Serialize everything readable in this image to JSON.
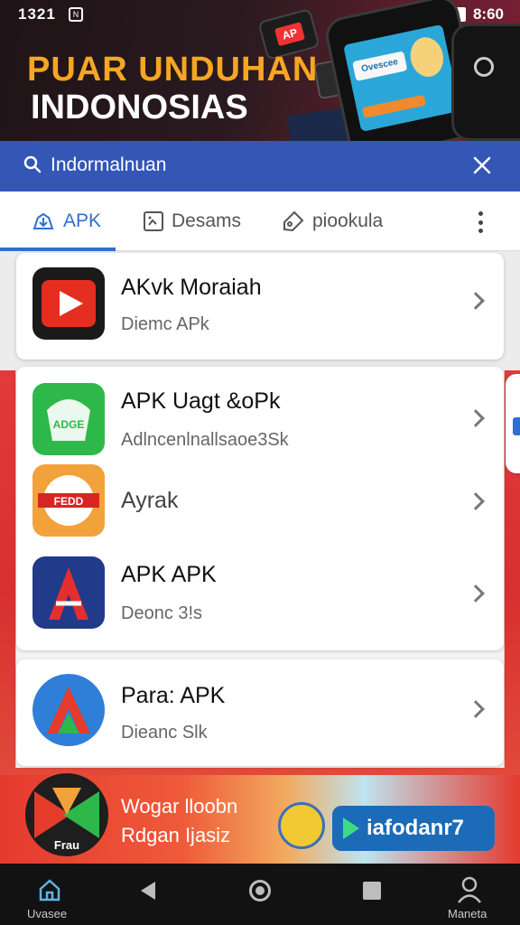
{
  "status_bar": {
    "time": "1321",
    "notification_glyph": "N",
    "battery_text": "8:60"
  },
  "hero": {
    "title_line1": "PUAR UNDUHAN",
    "title_line2": "INDONOSIAS",
    "device_badge": "AP",
    "screen_badge": "Ovescee"
  },
  "search": {
    "query": "Indormalnuan",
    "search_icon": "search-icon",
    "close_icon": "close-icon"
  },
  "tabs": [
    {
      "label": "APK",
      "icon": "download-icon",
      "active": true
    },
    {
      "label": "Desams",
      "icon": "image-icon",
      "active": false
    },
    {
      "label": "piookula",
      "icon": "tag-icon",
      "active": false
    }
  ],
  "apps": [
    {
      "name": "AKvk Moraiah",
      "subtitle": "Diemc APk"
    },
    {
      "name": "APK Uagt &oPk",
      "subtitle": "Adlncenlnallsaoe3Sk",
      "icon_text": "ADGE"
    },
    {
      "name": "Ayrak",
      "subtitle": "",
      "icon_text": "FEDD"
    },
    {
      "name": "APK APK",
      "subtitle": "Deonc 3!s"
    },
    {
      "name": "Para: APK",
      "subtitle": "Dieanc Slk"
    }
  ],
  "banner": {
    "line1": "Wogar lloobn",
    "line2": "Rdgan Ijasiz",
    "button_label": "iafodanr7",
    "logo_text": "Frau"
  },
  "navbar": {
    "home_label": "Uvasee",
    "profile_label": "Maneta"
  },
  "colors": {
    "primary_blue": "#3456b5",
    "accent_orange": "#f5a623",
    "banner_red": "#e43a2e"
  }
}
